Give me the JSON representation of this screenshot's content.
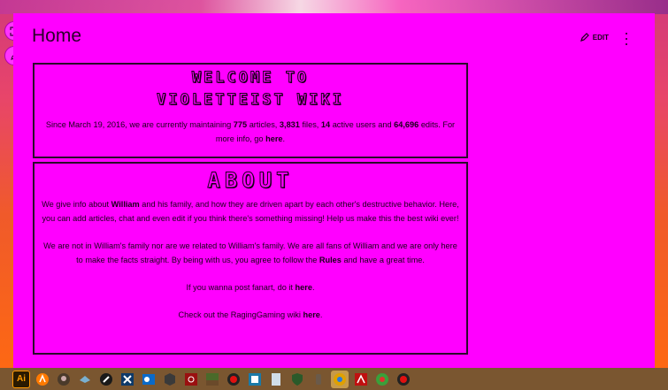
{
  "page": {
    "title": "Home",
    "edit_label": "EDIT"
  },
  "welcome": {
    "heading_line1": "WELCOME TO",
    "heading_line2": "VIOLETTEIST WIKI",
    "text_before": "Since March 19, 2016, we are currently maintaining ",
    "articles": "775",
    "t1": " articles, ",
    "files": "3,831",
    "t2": " files, ",
    "active_users": "14",
    "t3": " active users and ",
    "edits": "64,696",
    "t4": " edits. For more info, go ",
    "here_link": "here",
    "t5": "."
  },
  "about": {
    "heading": "ABOUT",
    "p1_a": "We give info about ",
    "p1_link": "William",
    "p1_b": " and his family, and how they are driven apart by each other's destructive behavior. Here, you can add articles, chat and even edit if you think there's something missing! Help us make this the best wiki ever!",
    "p2_a": "We are not in William's family nor are we related to William's family. We are all fans of William and we are only here to make the facts straight. By being with us, you agree to follow the ",
    "p2_link": "Rules",
    "p2_b": " and have a great time.",
    "p3_a": "If you wanna post fanart, do it ",
    "p3_link": "here",
    "p3_b": ".",
    "p4_a": "Check out the RagingGaming wiki ",
    "p4_link": "here",
    "p4_b": "."
  },
  "taskbar": {
    "icons": [
      "illustrator-icon",
      "avast-icon",
      "game-icon",
      "bird-icon",
      "compass-icon",
      "x-app-icon",
      "outlook-icon",
      "cube-icon",
      "biohazard-icon",
      "minecraft-icon",
      "record-icon",
      "frame-icon",
      "notepad-icon",
      "shield-icon",
      "usb-icon",
      "chrome-icon",
      "acrobat-icon",
      "chrome-alt-icon",
      "record-alt-icon"
    ],
    "illustrator_label": "Ai"
  },
  "colors": {
    "page_bg": "#ff00ff",
    "taskbar_bg": "#7a5630",
    "active_task": "#c79a4a"
  }
}
